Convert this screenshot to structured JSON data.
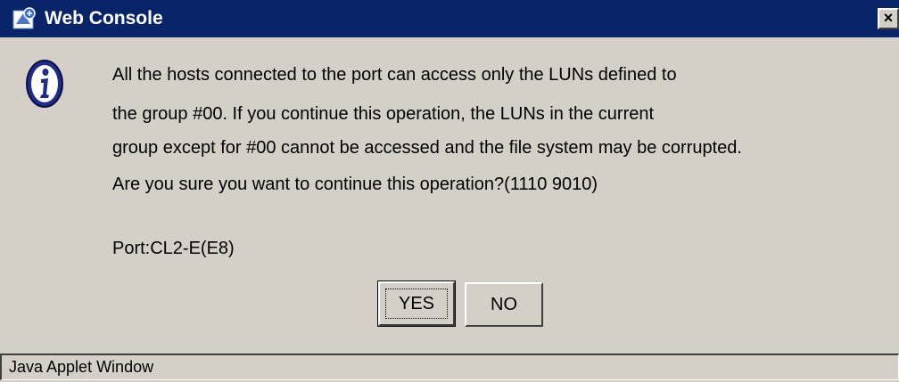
{
  "window": {
    "title": "Web Console",
    "close_label": "×",
    "title_icon": "java-applet-icon",
    "title_bar_color": "#0a246a"
  },
  "dialog": {
    "icon": "info-icon",
    "message_lines": [
      "All the hosts connected to the port can access only the LUNs defined to",
      "the group #00. If you continue this operation, the LUNs in the current",
      "group except for #00 cannot be accessed and the file system may be corrupted.",
      "Are you sure you want to continue this operation?(1110 9010)"
    ],
    "port_text": "Port:CL2-E(E8)",
    "yes_label": "YES",
    "no_label": "NO"
  },
  "status_bar": {
    "text": "Java Applet Window"
  }
}
